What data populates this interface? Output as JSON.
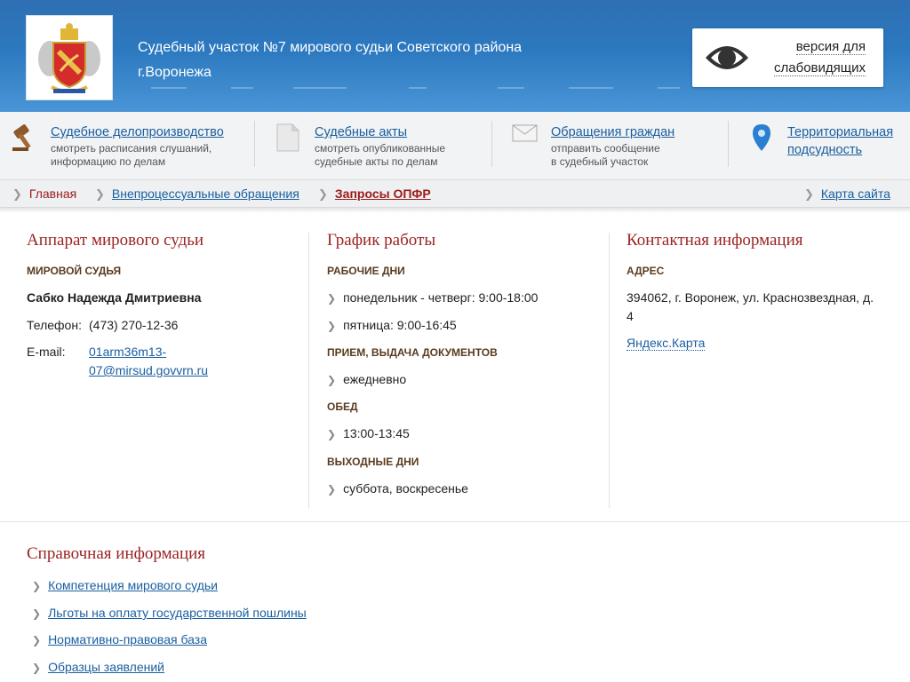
{
  "header": {
    "title_line1": "Судебный участок №7 мирового судьи Советского района",
    "title_line2": "г.Воронежа",
    "vision_line1": "версия для",
    "vision_line2": "слабовидящих"
  },
  "nav": [
    {
      "label": "Судебное делопроизводство",
      "desc1": "смотреть расписания слушаний,",
      "desc2": "информацию по делам",
      "icon": "gavel-icon"
    },
    {
      "label": "Судебные акты",
      "desc1": "смотреть опубликованные",
      "desc2": "судебные акты по делам",
      "icon": "document-icon"
    },
    {
      "label": "Обращения граждан",
      "desc1": "отправить сообщение",
      "desc2": "в судебный участок",
      "icon": "envelope-icon"
    },
    {
      "label1": "Территориальная",
      "label2": "подсудность",
      "icon": "map-pin-icon"
    }
  ],
  "breadcrumb": {
    "home": "Главная",
    "item2": "Внепроцессуальные обращения",
    "current": "Запросы ОПФР",
    "sitemap": "Карта сайта"
  },
  "apparatus": {
    "title": "Аппарат мирового судьи",
    "role": "МИРОВОЙ СУДЬЯ",
    "name": "Сабко Надежда Дмитриевна",
    "phone_label": "Телефон:",
    "phone": "(473) 270-12-36",
    "email_label": "E-mail:",
    "email_line1": "01arm36m13-",
    "email_line2": "07@mirsud.govvrn.ru"
  },
  "schedule": {
    "title": "График работы",
    "workdays_label": "РАБОЧИЕ ДНИ",
    "workdays": [
      "понедельник - четверг: 9:00-18:00",
      "пятница: 9:00-16:45"
    ],
    "docs_label": "ПРИЕМ, ВЫДАЧА ДОКУМЕНТОВ",
    "docs": "ежедневно",
    "lunch_label": "ОБЕД",
    "lunch": "13:00-13:45",
    "weekend_label": "ВЫХОДНЫЕ ДНИ",
    "weekend": "суббота, воскресенье"
  },
  "contacts": {
    "title": "Контактная информация",
    "address_label": "АДРЕС",
    "address_line1": "394062, г. Воронеж, ул. Краснозвездная, д.",
    "address_line2": "4",
    "map_link": "Яндекс.Карта"
  },
  "reference": {
    "title": "Справочная информация",
    "items": [
      "Компетенция мирового судьи",
      "Льготы на оплату государственной пошлины",
      "Нормативно-правовая база",
      "Образцы заявлений"
    ]
  },
  "colors": {
    "header_blue": "#2c79c0",
    "heading_red": "#9c2323",
    "link_blue": "#1a5fa0"
  }
}
